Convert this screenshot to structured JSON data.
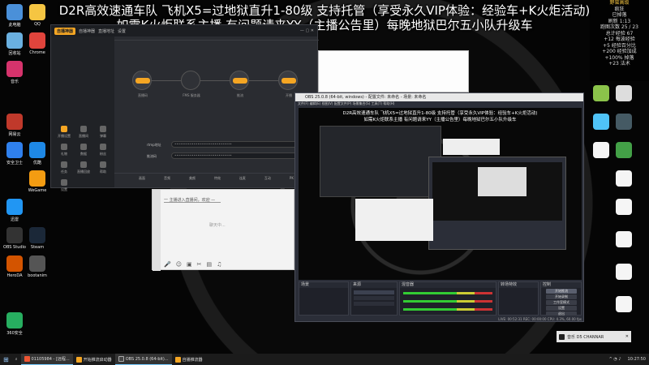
{
  "overlay": {
    "line1": "D2R高效速通车队 飞机X5=过地狱直升1-80级 支持托管（享受永久VIP体验：经验车+K火炬活动)",
    "line2": "如需K火炬联系主播 有问题请来YY（主播公告里）每晚地狱巴尔五小队升级车"
  },
  "desktop_icons": [
    {
      "label": "此电脑",
      "color": "#4a90d9"
    },
    {
      "label": "QQ",
      "color": "#f5c542"
    },
    {
      "label": "回收站",
      "color": "#6ab0e0"
    },
    {
      "label": "Chrome",
      "color": "#e0443c"
    },
    {
      "label": "音乐",
      "color": "#d6336c"
    },
    {
      "label": "网易云",
      "color": "#c0392b"
    },
    {
      "label": "安全卫士",
      "color": "#2f80ed"
    },
    {
      "label": "优酷",
      "color": "#1e88e5"
    },
    {
      "label": "WeGame",
      "color": "#f39c12"
    },
    {
      "label": "Steam",
      "color": "#1b2838"
    },
    {
      "label": "迅雷",
      "color": "#2196f3"
    },
    {
      "label": "HeroDA",
      "color": "#d35400"
    },
    {
      "label": "bootanim",
      "color": "#555"
    },
    {
      "label": "OBS Studio",
      "color": "#333"
    },
    {
      "label": "360安全",
      "color": "#27ae60"
    }
  ],
  "app": {
    "title_tabs": [
      "自播神器",
      "直播地址",
      "设置"
    ],
    "logo": "自播神器",
    "sidebar": [
      "开播设置",
      "直播间",
      "弹幕",
      "礼物",
      "数据",
      "粉丝",
      "任务",
      "直播回放",
      "帮助",
      "设置"
    ],
    "steps": [
      "直播码",
      "FMS 服务器",
      "推流",
      "开播"
    ],
    "rtmp_label": "rtmp地址",
    "key_label": "推流码",
    "copy_label": "复制",
    "toolbar": [
      "画面",
      "音频",
      "美颜",
      "特效",
      "连麦",
      "互动",
      "PK",
      "更多"
    ]
  },
  "chat": {
    "line": "一 主播进入直播间，欢迎 —",
    "status": "聊天中..."
  },
  "obs": {
    "title": "OBS 25.0.8 (64-bit, windows) - 配置文件: 未命名 - 场景: 未命名",
    "menu": "文件(F) 编辑(E) 视图(V) 配置文件(P) 场景集合(S) 工具(T) 帮助(H)",
    "docks": [
      "场景",
      "来源",
      "混音器",
      "转场特效",
      "控制"
    ],
    "controls": [
      "开始推流",
      "开始录制",
      "工作室模式",
      "设置",
      "退出"
    ],
    "status": "LIVE: 00:52:31  REC: 00:00:00  CPU: 4.3%, 60.00 fps"
  },
  "right_panel": {
    "lines": [
      "野蛮高级",
      "疯狂",
      "已掉落",
      "刷新 1:13",
      "跑图次数 25 / 23",
      "总计经验 67",
      "+12 每波经验",
      "+5 经验百分比",
      "+200 经验加成",
      "+100% 掉落",
      "+23 法术"
    ]
  },
  "taskbar": {
    "items": [
      "01105984 - [远程...",
      "开始推流启动器",
      "OBS 25.0.8 (64-bit)...",
      "自播推流器"
    ],
    "clock": "10:27:50"
  },
  "notification": {
    "text": "音乐  D5 CHANNAR"
  }
}
